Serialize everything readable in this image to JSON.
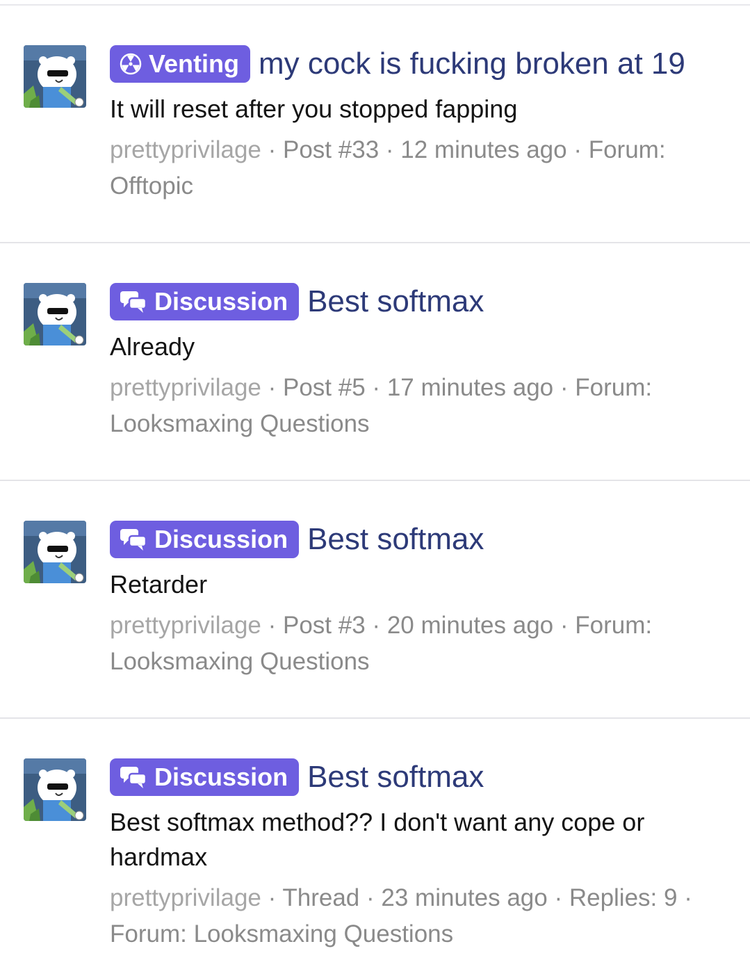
{
  "results": [
    {
      "label": "Venting",
      "label_icon": "radiation-icon",
      "title": "my cock is fucking broken at 19",
      "snippet": "It will reset after you stopped fapping",
      "meta": {
        "user": "prettyprivilage",
        "type": "Post #33",
        "time": "12 minutes ago",
        "extra": "",
        "forum_prefix": "Forum:",
        "forum": "Offtopic"
      }
    },
    {
      "label": "Discussion",
      "label_icon": "chat-bubbles-icon",
      "title": "Best softmax",
      "snippet": "Already",
      "meta": {
        "user": "prettyprivilage",
        "type": "Post #5",
        "time": "17 minutes ago",
        "extra": "",
        "forum_prefix": "Forum:",
        "forum": "Looksmaxing Questions"
      }
    },
    {
      "label": "Discussion",
      "label_icon": "chat-bubbles-icon",
      "title": "Best softmax",
      "snippet": "Retarder",
      "meta": {
        "user": "prettyprivilage",
        "type": "Post #3",
        "time": "20 minutes ago",
        "extra": "",
        "forum_prefix": "Forum:",
        "forum": "Looksmaxing Questions"
      }
    },
    {
      "label": "Discussion",
      "label_icon": "chat-bubbles-icon",
      "title": "Best softmax",
      "snippet": "Best softmax method?? I don't want any cope or hardmax",
      "meta": {
        "user": "prettyprivilage",
        "type": "Thread",
        "time": "23 minutes ago",
        "extra": "Replies: 9",
        "forum_prefix": "Forum:",
        "forum": "Looksmaxing Questions"
      }
    }
  ],
  "colors": {
    "label_bg": "#6e5ee0",
    "title": "#2d3a78",
    "meta": "#8a8a8a"
  }
}
